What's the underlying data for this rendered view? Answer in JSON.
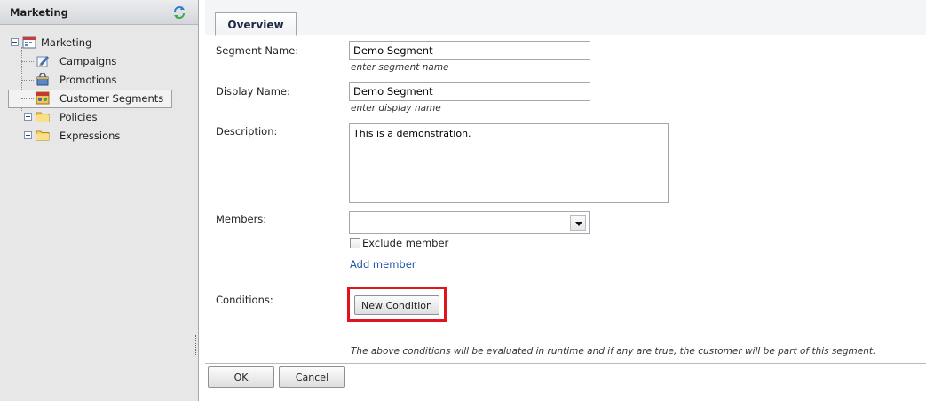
{
  "sidebar": {
    "title": "Marketing",
    "tree": {
      "root": {
        "label": "Marketing",
        "icon": "calendar-icon",
        "expanded": true
      },
      "children": [
        {
          "label": "Campaigns",
          "icon": "pen-document-icon"
        },
        {
          "label": "Promotions",
          "icon": "shopping-bag-icon"
        },
        {
          "label": "Customer Segments",
          "icon": "customer-segments-icon",
          "selected": true
        }
      ],
      "folders": [
        {
          "label": "Policies",
          "icon": "folder-icon",
          "expanded": false
        },
        {
          "label": "Expressions",
          "icon": "folder-icon",
          "expanded": false
        }
      ]
    }
  },
  "tabs": [
    {
      "label": "Overview",
      "active": true
    }
  ],
  "form": {
    "segment_name": {
      "label": "Segment Name:",
      "value": "Demo Segment",
      "hint": "enter segment name"
    },
    "display_name": {
      "label": "Display Name:",
      "value": "Demo Segment",
      "hint": "enter display name"
    },
    "description": {
      "label": "Description:",
      "value": "This is a demonstration."
    },
    "members": {
      "label": "Members:",
      "selected": "",
      "exclude_label": "Exclude member",
      "exclude_checked": false,
      "add_link": "Add member"
    },
    "conditions": {
      "label": "Conditions:",
      "new_button": "New Condition",
      "note": "The above conditions will be evaluated in runtime and if any are true, the customer will be part of this segment."
    }
  },
  "footer": {
    "ok_label": "OK",
    "cancel_label": "Cancel"
  },
  "colors": {
    "highlight": "#e0141c",
    "link": "#2054a8",
    "sidebar_bg": "#e7e7e7"
  }
}
